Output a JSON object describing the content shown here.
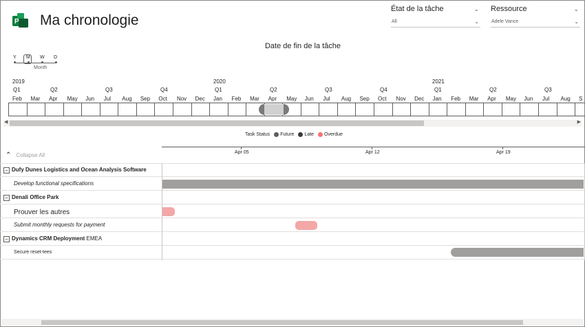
{
  "app": {
    "title": "Ma chronologie"
  },
  "slicers": [
    {
      "label": "État de la tâche",
      "value": "All"
    },
    {
      "label": "Ressource",
      "value": "Adele Vance"
    }
  ],
  "chart_title": "Date de fin de la tâche",
  "zoom": {
    "levels": [
      "Y",
      "M",
      "W",
      "D"
    ],
    "selected": "M",
    "caption": "Month"
  },
  "navigator": {
    "years": [
      "2019",
      "2020",
      "2021"
    ],
    "quarters": [
      "Q1",
      "Q2",
      "Q3",
      "Q4",
      "Q1",
      "Q2",
      "Q3",
      "Q4",
      "Q1",
      "Q2",
      "Q3"
    ],
    "months": [
      "Feb",
      "Mar",
      "Apr",
      "May",
      "Jun",
      "Jul",
      "Aug",
      "Sep",
      "Oct",
      "Nov",
      "Dec",
      "Jan",
      "Feb",
      "Mar",
      "Apr",
      "May",
      "Jun",
      "Jul",
      "Aug",
      "Sep",
      "Oct",
      "Nov",
      "Dec",
      "Jan",
      "Feb",
      "Mar",
      "Apr",
      "May",
      "Jun",
      "Jul",
      "Aug",
      "S"
    ]
  },
  "legend": {
    "title": "Task Status",
    "items": [
      {
        "label": "Future",
        "color": "#605e5c"
      },
      {
        "label": "Late",
        "color": "#3b3a39"
      },
      {
        "label": "Overdue",
        "color": "#f87171"
      }
    ]
  },
  "timeline_axis": {
    "ticks": [
      "Apr 05",
      "Apr 12",
      "Apr 19"
    ]
  },
  "collapse_all": "Collapse All",
  "colors": {
    "future_bar": "#a19f9d",
    "overdue_bar": "#f4a7a7",
    "navigator_window": "#d0d0d0"
  },
  "rows": [
    {
      "type": "group",
      "label": "Dufy Dunes Logistics and Ocean Analysis Software"
    },
    {
      "type": "task",
      "label": "Develop functional specifications",
      "status": "future"
    },
    {
      "type": "group",
      "label": "Denali Office Park"
    },
    {
      "type": "task",
      "label": "Prouver les autres",
      "status": "overdue"
    },
    {
      "type": "task",
      "label": "Submit monthly requests for payment",
      "status": "overdue"
    },
    {
      "type": "group",
      "label": "Dynamics CRM Deployment",
      "suffix": "EMEA"
    },
    {
      "type": "task",
      "label": "Secure reset-tees",
      "status": "future"
    }
  ]
}
